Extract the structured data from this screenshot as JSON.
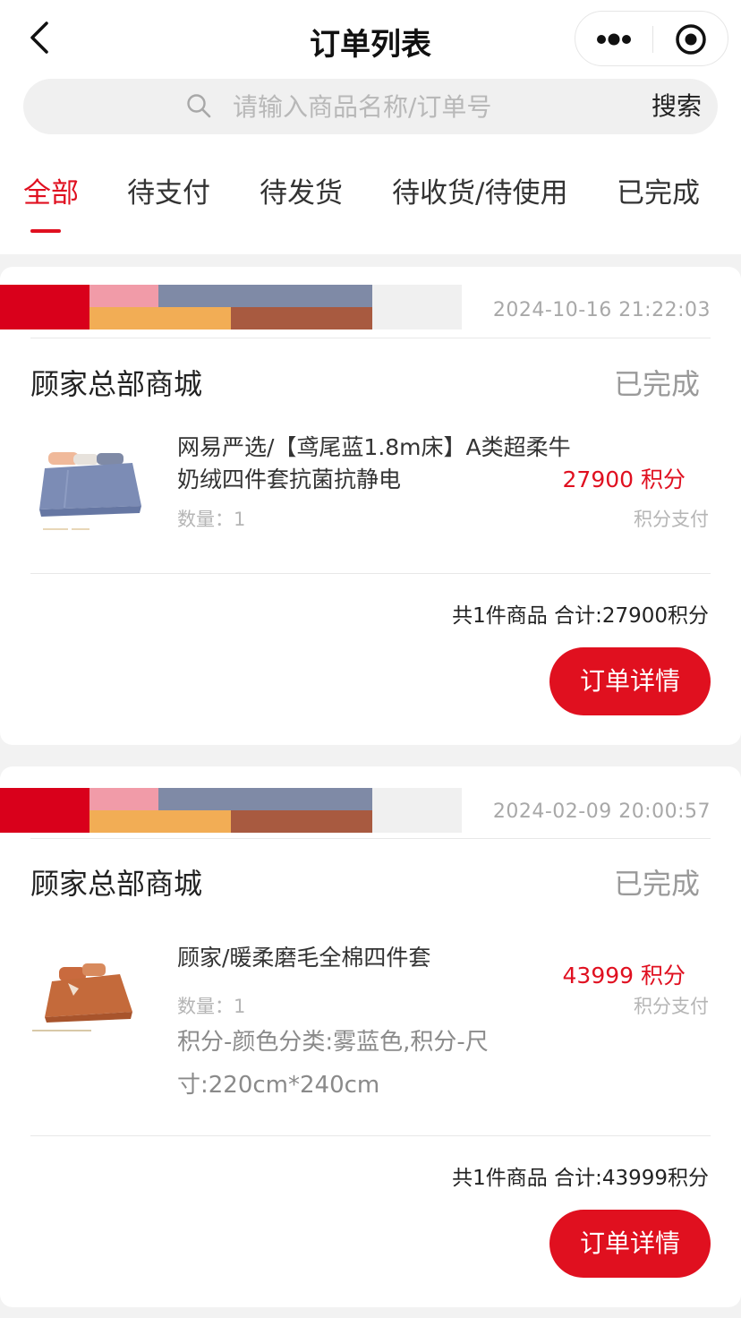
{
  "nav": {
    "title": "订单列表"
  },
  "search": {
    "placeholder": "请输入商品名称/订单号",
    "button": "搜索"
  },
  "tabs": [
    "全部",
    "待支付",
    "待发货",
    "待收货/待使用",
    "已完成"
  ],
  "active_tab": "全部",
  "colors": {
    "accent": "#e01020",
    "strip": [
      "#d9001b",
      "#f19ba8",
      "#7f8aa6",
      "#f2ad55",
      "#a85a40",
      "#f0f0f0"
    ]
  },
  "orders": [
    {
      "time": "2024-10-16 21:22:03",
      "shop": "顾家总部商城",
      "status": "已完成",
      "product": {
        "title": "网易严选/【鸢尾蓝1.8m床】A类超柔牛奶绒四件套抗菌抗静电",
        "qty": "数量：1",
        "price": "27900 积分",
        "pay": "积分支付"
      },
      "summary": "共1件商品 合计:27900积分",
      "button": "订单详情"
    },
    {
      "time": "2024-02-09 20:00:57",
      "shop": "顾家总部商城",
      "status": "已完成",
      "product": {
        "title": "顾家/暖柔磨毛全棉四件套",
        "qty": "数量：1",
        "spec": "积分-颜色分类:雾蓝色,积分-尺寸:220cm*240cm",
        "price": "43999 积分",
        "pay": "积分支付"
      },
      "summary": "共1件商品 合计:43999积分",
      "button": "订单详情"
    }
  ]
}
